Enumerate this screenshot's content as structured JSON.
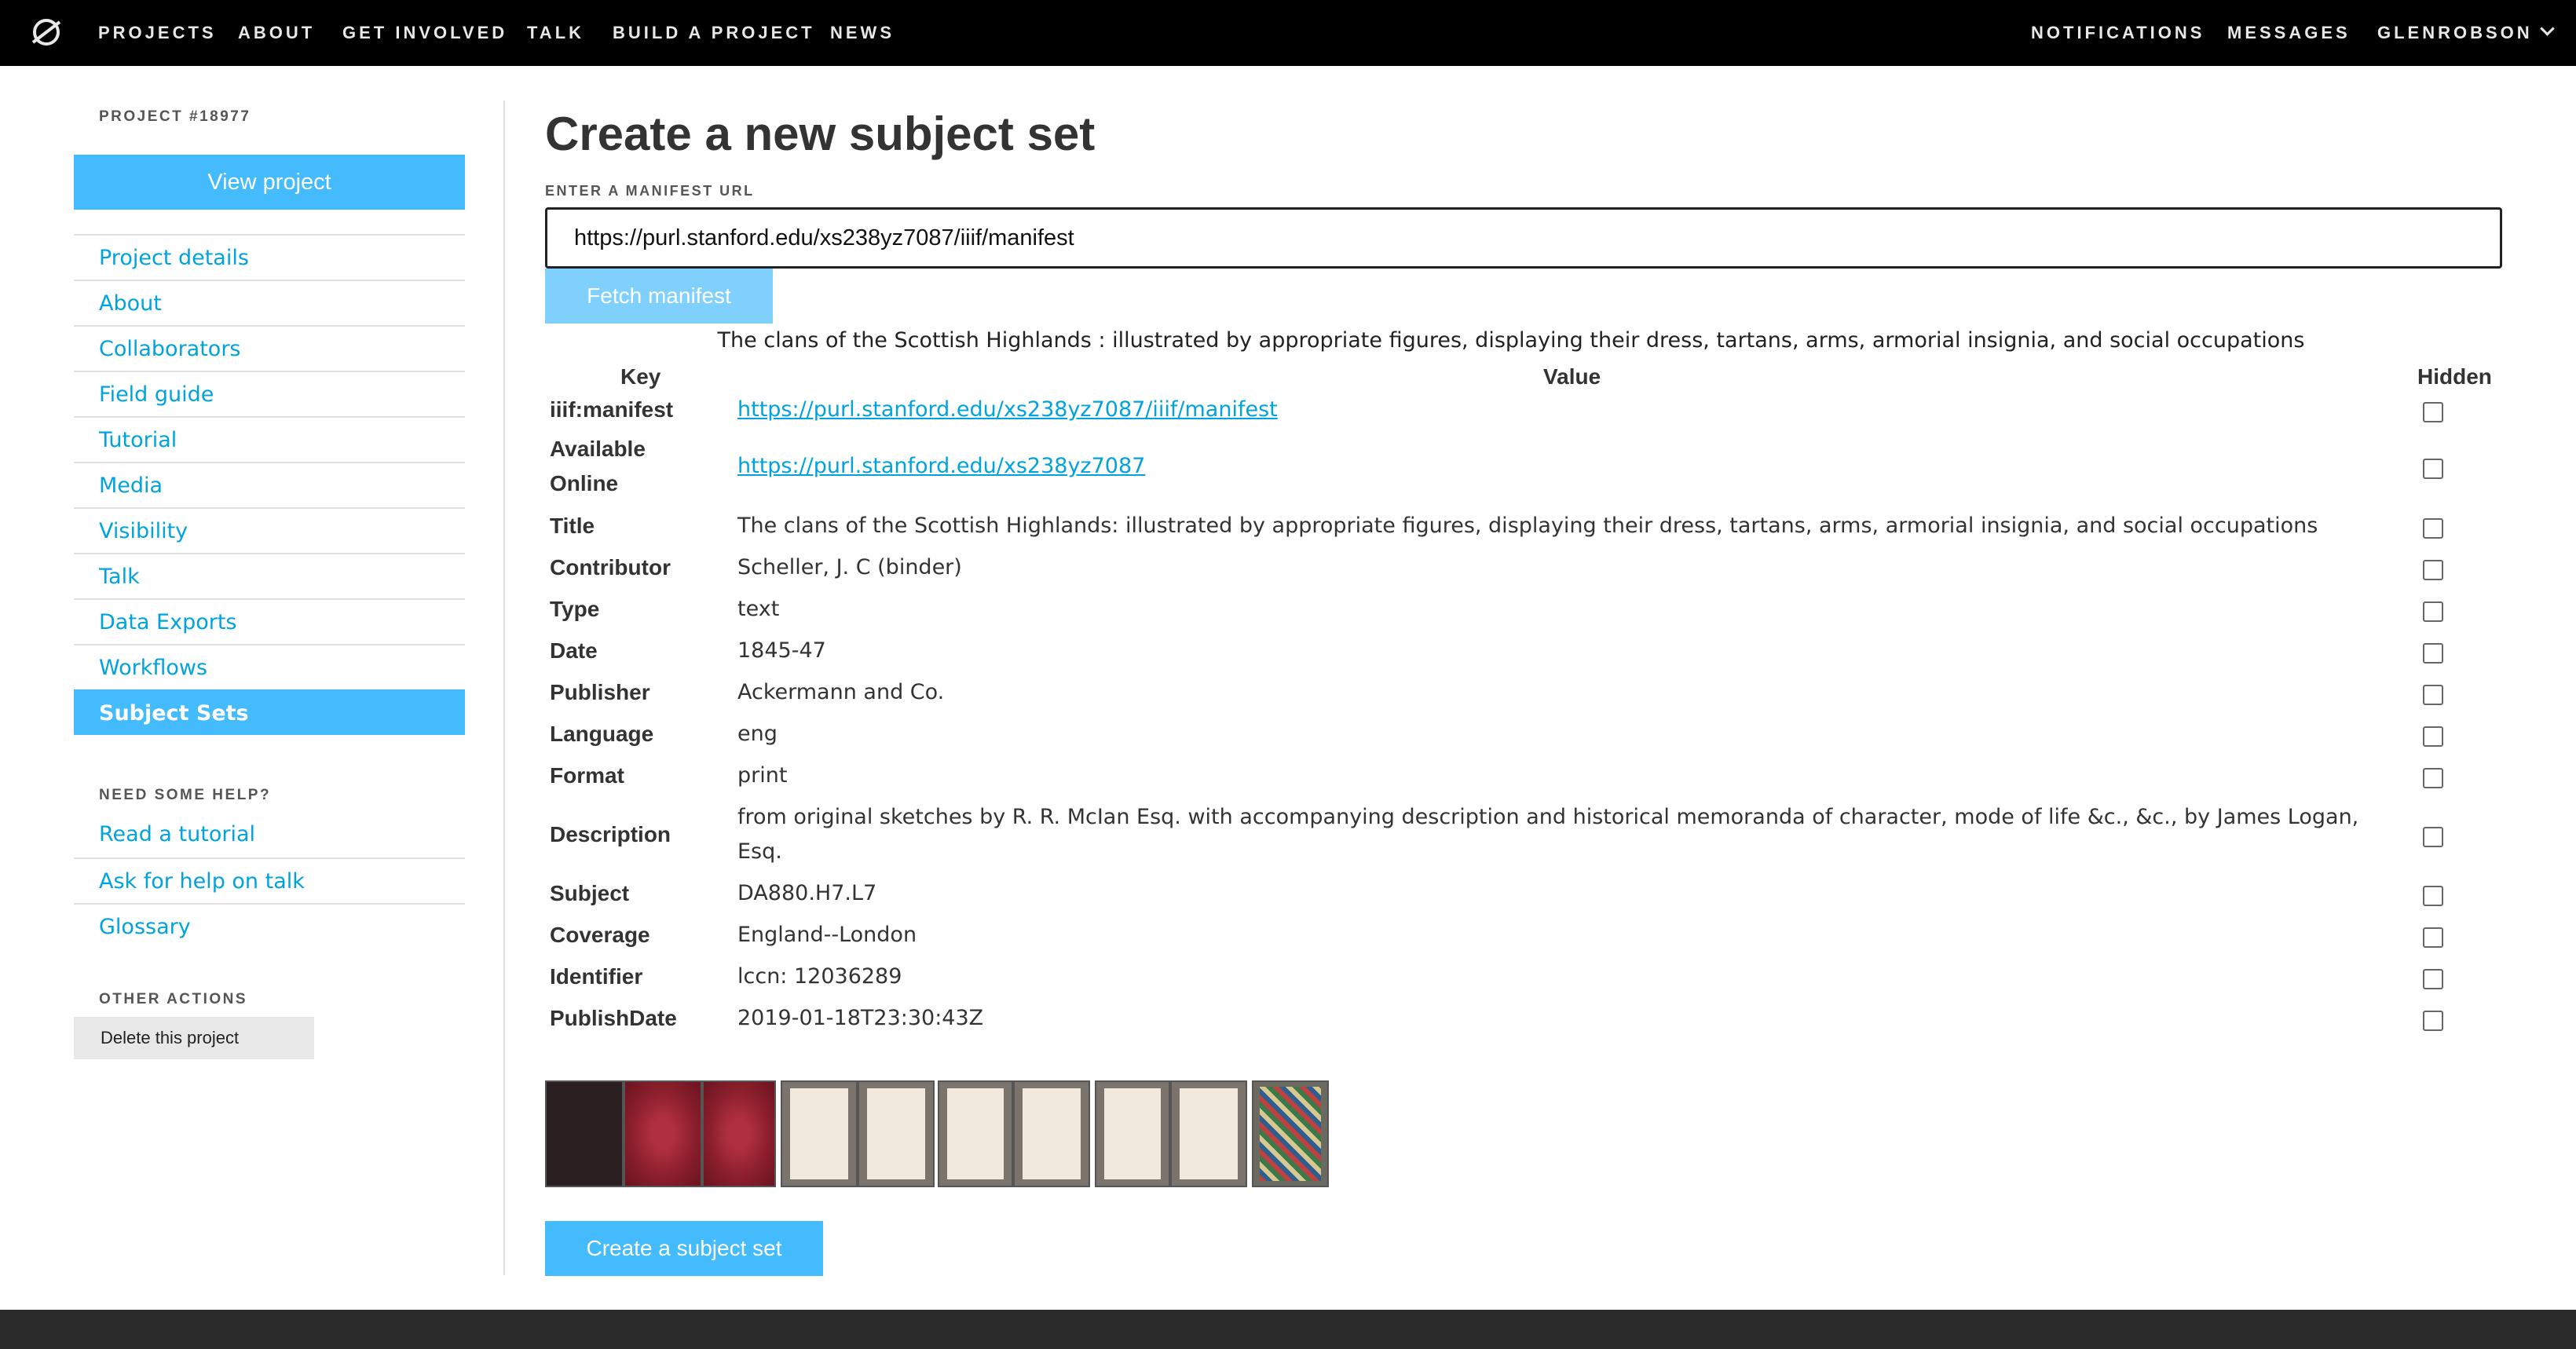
{
  "nav": {
    "left": [
      "PROJECTS",
      "ABOUT",
      "GET INVOLVED",
      "TALK",
      "BUILD A PROJECT",
      "NEWS"
    ],
    "notifications": "NOTIFICATIONS",
    "messages": "MESSAGES",
    "user": "GLENROBSON"
  },
  "sidebar": {
    "project_label": "PROJECT #18977",
    "view_project": "View project",
    "items": [
      "Project details",
      "About",
      "Collaborators",
      "Field guide",
      "Tutorial",
      "Media",
      "Visibility",
      "Talk",
      "Data Exports",
      "Workflows",
      "Subject Sets"
    ],
    "active_item": "Subject Sets",
    "help_heading": "NEED SOME HELP?",
    "help_items": [
      "Read a tutorial",
      "Ask for help on talk",
      "Glossary"
    ],
    "other_heading": "OTHER ACTIONS",
    "delete_project": "Delete this project"
  },
  "main": {
    "title": "Create a new subject set",
    "manifest_label": "ENTER A MANIFEST URL",
    "manifest_value": "https://purl.stanford.edu/xs238yz7087/iiif/manifest",
    "fetch_button": "Fetch manifest",
    "caption": "The clans of the Scottish Highlands : illustrated by appropriate figures, displaying their dress, tartans, arms, armorial insignia, and social occupations",
    "headers": {
      "key": "Key",
      "value": "Value",
      "hidden": "Hidden"
    },
    "rows": [
      {
        "key": "iiif:manifest",
        "value": "https://purl.stanford.edu/xs238yz7087/iiif/manifest",
        "link": true
      },
      {
        "key": "Available Online",
        "value": "https://purl.stanford.edu/xs238yz7087",
        "link": true
      },
      {
        "key": "Title",
        "value": "The clans of the Scottish Highlands: illustrated by appropriate figures, displaying their dress, tartans, arms, armorial insignia, and social occupations"
      },
      {
        "key": "Contributor",
        "value": "Scheller, J. C (binder)"
      },
      {
        "key": "Type",
        "value": "text"
      },
      {
        "key": "Date",
        "value": "1845-47"
      },
      {
        "key": "Publisher",
        "value": "Ackermann and Co."
      },
      {
        "key": "Language",
        "value": "eng"
      },
      {
        "key": "Format",
        "value": "print"
      },
      {
        "key": "Description",
        "value": "from original sketches by R. R. McIan Esq. with accompanying description and historical memoranda of character, mode of life &c., &c., by James Logan, Esq."
      },
      {
        "key": "Subject",
        "value": "DA880.H7.L7"
      },
      {
        "key": "Coverage",
        "value": "England--London"
      },
      {
        "key": "Identifier",
        "value": "lccn: 12036289"
      },
      {
        "key": "PublishDate",
        "value": "2019-01-18T23:30:43Z"
      }
    ],
    "thumbnails": [
      "cover-dark",
      "cover-red",
      "cover-red",
      "page-bookplate",
      "page-blank",
      "page-blank",
      "page-blank",
      "page-blank",
      "page-blank",
      "plate-color"
    ],
    "create_button": "Create a subject set"
  },
  "colors": {
    "accent": "#43bbfd",
    "link": "#00a3dd",
    "topbar": "#000000",
    "footer": "#2a2a2a"
  }
}
